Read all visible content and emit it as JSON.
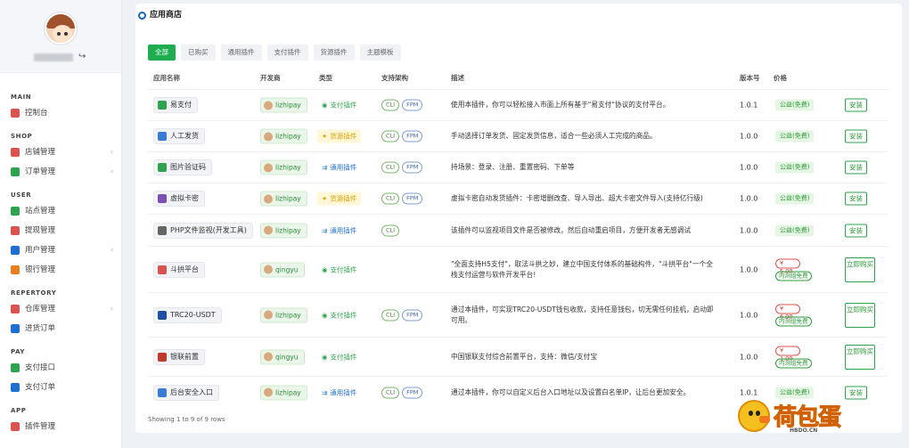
{
  "sidebar": {
    "sections": [
      {
        "title": "MAIN",
        "items": [
          {
            "label": "控制台",
            "icon": "dashboard-icon",
            "color": "#d9534f",
            "chevron": false
          }
        ]
      },
      {
        "title": "SHOP",
        "items": [
          {
            "label": "店铺管理",
            "icon": "store-icon",
            "color": "#d9534f",
            "chevron": true
          },
          {
            "label": "订单管理",
            "icon": "order-icon",
            "color": "#2ea24d",
            "chevron": true
          }
        ]
      },
      {
        "title": "USER",
        "items": [
          {
            "label": "站点管理",
            "icon": "site-icon",
            "color": "#2ea24d",
            "chevron": false
          },
          {
            "label": "提现管理",
            "icon": "withdraw-icon",
            "color": "#d9534f",
            "chevron": false
          },
          {
            "label": "用户管理",
            "icon": "user-icon",
            "color": "#1e6fd0",
            "chevron": true
          },
          {
            "label": "银行管理",
            "icon": "bank-icon",
            "color": "#e67e22",
            "chevron": false
          }
        ]
      },
      {
        "title": "REPERTORY",
        "items": [
          {
            "label": "仓库管理",
            "icon": "warehouse-icon",
            "color": "#d9534f",
            "chevron": true
          },
          {
            "label": "进货订单",
            "icon": "purchase-icon",
            "color": "#1e6fd0",
            "chevron": false
          }
        ]
      },
      {
        "title": "PAY",
        "items": [
          {
            "label": "支付接口",
            "icon": "payment-icon",
            "color": "#2ea24d",
            "chevron": false
          },
          {
            "label": "支付订单",
            "icon": "pay-order-icon",
            "color": "#1e6fd0",
            "chevron": false
          }
        ]
      },
      {
        "title": "APP",
        "items": [
          {
            "label": "插件管理",
            "icon": "plugin-icon",
            "color": "#d9534f",
            "chevron": false
          }
        ]
      }
    ]
  },
  "page": {
    "title": "应用商店"
  },
  "tabs": [
    "全部",
    "已购买",
    "通用插件",
    "支付插件",
    "货源插件",
    "主题模板"
  ],
  "columns": [
    "应用名称",
    "开发商",
    "类型",
    "支持架构",
    "描述",
    "版本号",
    "价格"
  ],
  "rows": [
    {
      "name": "易支付",
      "icon_color": "#2ea24d",
      "dev": "lizhipay",
      "type": "支付插件",
      "type_kind": "pay",
      "arch": [
        "CLI",
        "FPM"
      ],
      "desc": "使用本插件，你可以轻松接入市面上所有基于\"易支付\"协议的支付平台。",
      "version": "1.0.1",
      "price": "公益(免费)",
      "paid": false,
      "action": "安装"
    },
    {
      "name": "人工发货",
      "icon_color": "#3a7bd5",
      "dev": "lizhipay",
      "type": "货源插件",
      "type_kind": "src",
      "arch": [
        "CLI",
        "FPM"
      ],
      "desc": "手动选择订单发货、固定发货信息，适合一些必须人工完成的商品。",
      "version": "1.0.0",
      "price": "公益(免费)",
      "paid": false,
      "action": "安装"
    },
    {
      "name": "图片验证码",
      "icon_color": "#2ea24d",
      "dev": "lizhipay",
      "type": "通用插件",
      "type_kind": "gen",
      "arch": [
        "CLI",
        "FPM"
      ],
      "desc": "持场景：登录、注册、重置密码、下单等",
      "version": "1.0.0",
      "price": "公益(免费)",
      "paid": false,
      "action": "安装"
    },
    {
      "name": "虚拟卡密",
      "icon_color": "#7b4fb5",
      "dev": "lizhipay",
      "type": "货源插件",
      "type_kind": "src",
      "arch": [
        "CLI",
        "FPM"
      ],
      "desc": "虚拟卡密自动发货插件：卡密增删改查、导入导出、超大卡密文件导入(支持亿行级)",
      "version": "1.0.0",
      "price": "公益(免费)",
      "paid": false,
      "action": "安装"
    },
    {
      "name": "PHP文件监视(开发工具)",
      "icon_color": "#666666",
      "dev": "lizhipay",
      "type": "通用插件",
      "type_kind": "gen",
      "arch": [
        "CLI"
      ],
      "desc": "该插件可以监视项目文件是否被修改，然后自动重启项目，方便开发者无感调试",
      "version": "1.0.0",
      "price": "公益(免费)",
      "paid": false,
      "action": "安装"
    },
    {
      "name": "斗拱平台",
      "icon_color": "#d9534f",
      "dev": "qingyu",
      "type": "支付插件",
      "type_kind": "pay",
      "arch": [],
      "desc": "\"全面支持H5支付\"，取法斗拱之妙，建立中国支付体系的基础构件，\"斗拱平台\"一个全栈支付运营与软件开发平台!",
      "version": "1.0.0",
      "price": "¥ 5.00",
      "vip": "内测组免费",
      "paid": true,
      "action": "立即购买"
    },
    {
      "name": "TRC20-USDT",
      "icon_color": "#1e4fa0",
      "dev": "lizhipay",
      "type": "支付插件",
      "type_kind": "pay",
      "arch": [
        "CLI",
        "FPM"
      ],
      "desc": "通过本插件，可实现TRC20-USDT钱包收款，支持任意钱包，切无需任何挂机，启动即可用。",
      "version": "1.0.0",
      "price": "¥ 6.90",
      "vip": "内测组免费",
      "paid": true,
      "action": "立即购买"
    },
    {
      "name": "银联前置",
      "icon_color": "#c0392b",
      "dev": "qingyu",
      "type": "支付插件",
      "type_kind": "pay",
      "arch": [],
      "desc": "中国银联支付综合前置平台，支持：微信/支付宝",
      "version": "1.0.0",
      "price": "¥ 1.00",
      "vip": "内测组免费",
      "paid": true,
      "action": "立即购买"
    },
    {
      "name": "后台安全入口",
      "icon_color": "#3a7bd5",
      "dev": "lizhipay",
      "type": "通用插件",
      "type_kind": "gen",
      "arch": [
        "CLI",
        "FPM"
      ],
      "desc": "通过本插件，你可以自定义后台入口地址以及设置白名单IP，让后台更加安全。",
      "version": "1.0.1",
      "price": "公益(免费)",
      "paid": false,
      "action": "安装"
    }
  ],
  "footer": "Showing 1 to 9 of 9 rows",
  "watermark": {
    "text": "荷包蛋",
    "sub": "HBDO.CN"
  }
}
